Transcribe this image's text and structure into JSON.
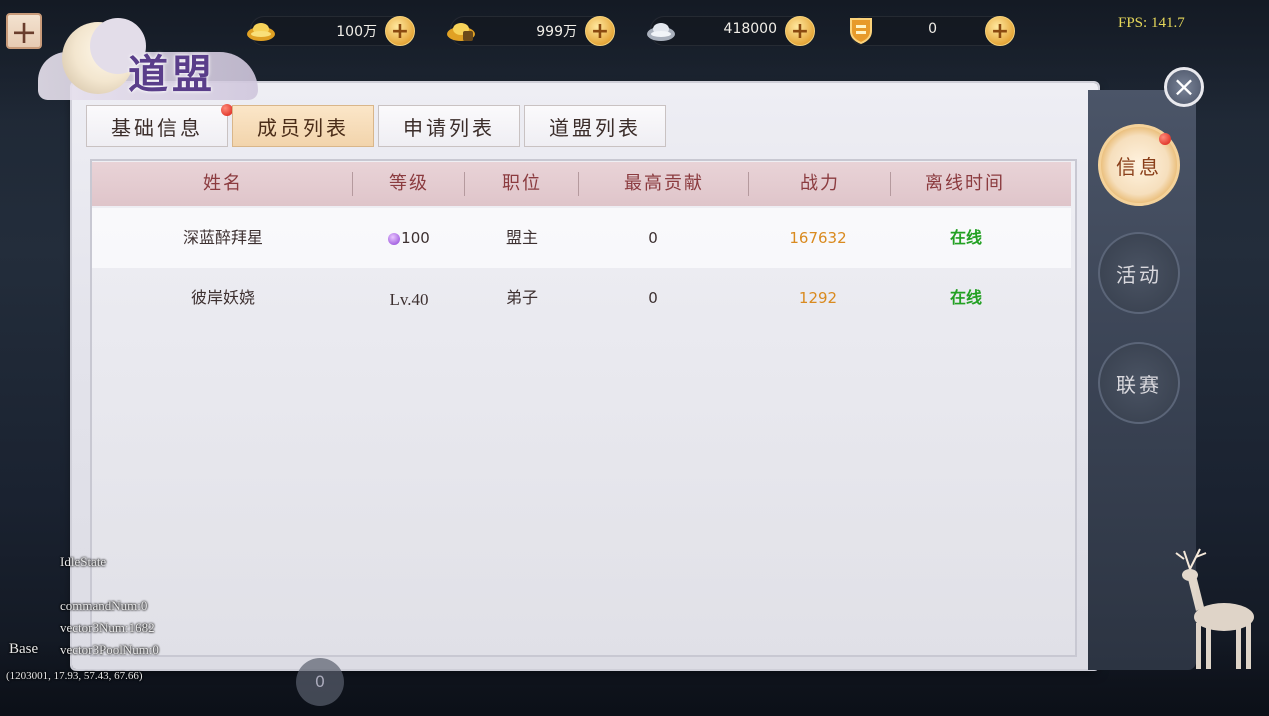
{
  "hud": {
    "add_label": "+",
    "fps": "FPS: 141.7",
    "currencies": [
      {
        "icon": "gold-ingot-icon",
        "value": "100万",
        "add": "+"
      },
      {
        "icon": "bound-gold-ingot-icon",
        "value": "999万",
        "add": "+"
      },
      {
        "icon": "silver-ingot-icon",
        "value": "418000",
        "add": "+"
      },
      {
        "icon": "shield-token-icon",
        "value": "0",
        "add": "+"
      }
    ]
  },
  "panel": {
    "title": "道盟",
    "close_label": "×",
    "tabs": [
      {
        "label": "基础信息",
        "badge": true,
        "active": false
      },
      {
        "label": "成员列表",
        "badge": false,
        "active": true
      },
      {
        "label": "申请列表",
        "badge": false,
        "active": false
      },
      {
        "label": "道盟列表",
        "badge": false,
        "active": false
      }
    ],
    "columns": [
      "姓名",
      "等级",
      "职位",
      "最高贡献",
      "战力",
      "离线时间"
    ],
    "rows": [
      {
        "name": "深蓝醉拜星",
        "level": "100",
        "level_icon": "purple-level-icon",
        "position": "盟主",
        "contribution": "0",
        "power": "167632",
        "status": "在线"
      },
      {
        "name": "彼岸妖娆",
        "level": "Lv.40",
        "position": "弟子",
        "contribution": "0",
        "power": "1292",
        "status": "在线"
      }
    ]
  },
  "side_nav": [
    {
      "label": "信息",
      "active": true,
      "badge": true
    },
    {
      "label": "活动",
      "active": false,
      "badge": false
    },
    {
      "label": "联赛",
      "active": false,
      "badge": false
    }
  ],
  "debug": {
    "state": "IdleState",
    "command_num": "commandNum:0",
    "vector3_num": "vector3Num:1682",
    "vector3pool_num": "vector3PoolNum:0",
    "base": "Base",
    "coords": "(1203001, 17.93, 57.43, 67.66)",
    "bottom_counter": "0"
  },
  "colors": {
    "power": "#d98a1f",
    "online": "#23a023",
    "header_text": "#8b3b3f",
    "accent_gold": "#e6a83c"
  }
}
